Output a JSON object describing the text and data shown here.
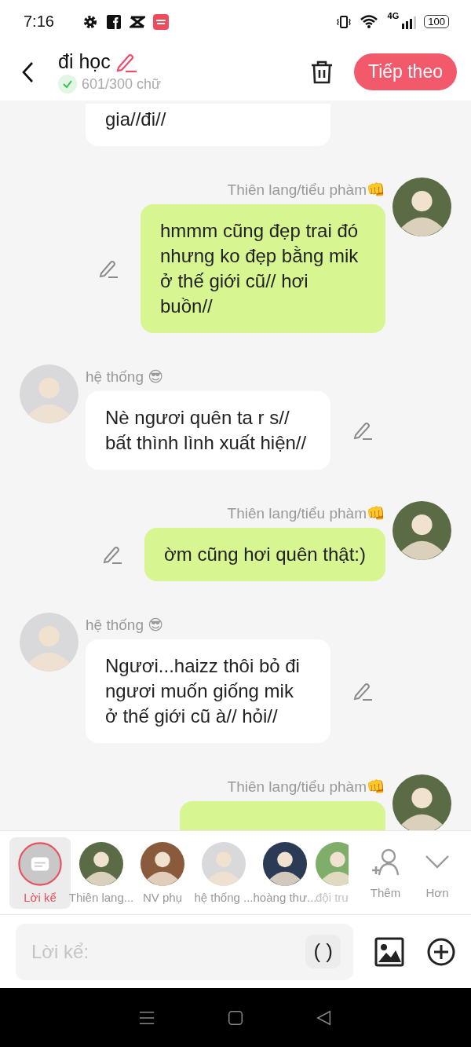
{
  "status_bar": {
    "time": "7:16",
    "network": "4G",
    "battery": "100"
  },
  "header": {
    "title": "đi học",
    "word_count": "601/300 chữ",
    "next_button": "Tiếp theo"
  },
  "messages": [
    {
      "kind": "other",
      "text": "gia//đi//"
    },
    {
      "kind": "self",
      "speaker": "Thiên lang/tiểu phàm👊",
      "text": "hmmm cũng đẹp trai đó nhưng ko đẹp bằng mik ở thế giới cũ// hơi buồn//",
      "color": "#5b6b45"
    },
    {
      "kind": "other",
      "speaker": "hệ thống 😎",
      "text": "Nè ngươi quên ta r s// bất thình lình xuất hiện//",
      "color": "#d9d9dc"
    },
    {
      "kind": "self",
      "speaker": "Thiên lang/tiểu phàm👊",
      "text": "ờm cũng hơi quên thật:)",
      "color": "#5b6b45"
    },
    {
      "kind": "other",
      "speaker": "hệ thống 😎",
      "text": "Ngươi...haizz thôi bỏ đi ngươi muốn giống mik ở thế giới cũ à// hỏi//",
      "color": "#d9d9dc"
    },
    {
      "kind": "self",
      "speaker": "Thiên lang/tiểu phàm👊",
      "color": "#5b6b45"
    }
  ],
  "characters": [
    {
      "kind": "narrator",
      "name": "Lời kể",
      "selected": true
    },
    {
      "kind": "avatar",
      "name": "Thiên lang...",
      "selected": false,
      "color": "#5b6b45"
    },
    {
      "kind": "avatar",
      "name": "NV phụ",
      "selected": false,
      "color": "#8a5a3c"
    },
    {
      "kind": "avatar",
      "name": "hệ thống ...",
      "selected": false,
      "color": "#d9d9dc"
    },
    {
      "kind": "avatar",
      "name": "hoàng thư...",
      "selected": false,
      "color": "#2b3a55"
    },
    {
      "kind": "avatar",
      "name": "đội trư",
      "selected": false,
      "color": "#7fae6a"
    }
  ],
  "actions": [
    {
      "kind": "add",
      "label": "Thêm"
    },
    {
      "kind": "more",
      "label": "Hơn"
    }
  ],
  "composer": {
    "placeholder": "Lời kể:",
    "bracket_button": "( )"
  }
}
